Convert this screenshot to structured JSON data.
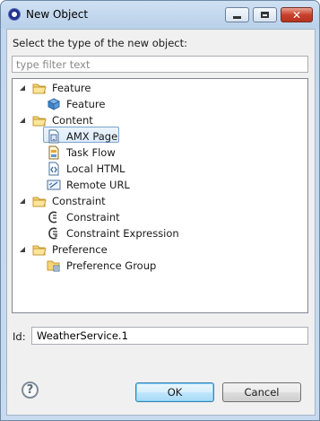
{
  "window": {
    "title": "New Object"
  },
  "dialog": {
    "prompt": "Select the type of the new object:",
    "filter": {
      "placeholder": "type filter text",
      "value": ""
    },
    "tree": [
      {
        "label": "Feature",
        "icon": "folder-icon",
        "expanded": true,
        "children": [
          {
            "label": "Feature",
            "icon": "feature-icon"
          }
        ]
      },
      {
        "label": "Content",
        "icon": "folder-icon",
        "expanded": true,
        "children": [
          {
            "label": "AMX Page",
            "icon": "amx-page-icon",
            "selected": true
          },
          {
            "label": "Task Flow",
            "icon": "task-flow-icon"
          },
          {
            "label": "Local HTML",
            "icon": "local-html-icon"
          },
          {
            "label": "Remote URL",
            "icon": "remote-url-icon"
          }
        ]
      },
      {
        "label": "Constraint",
        "icon": "folder-icon",
        "expanded": true,
        "children": [
          {
            "label": "Constraint",
            "icon": "constraint-icon"
          },
          {
            "label": "Constraint Expression",
            "icon": "constraint-expression-icon"
          }
        ]
      },
      {
        "label": "Preference",
        "icon": "folder-icon",
        "expanded": true,
        "children": [
          {
            "label": "Preference Group",
            "icon": "preference-group-icon"
          }
        ]
      }
    ],
    "id_label": "Id:",
    "id_value": "WeatherService.1",
    "ok_label": "OK",
    "cancel_label": "Cancel",
    "help_glyph": "?"
  },
  "colors": {
    "selection_fill": "#dcebfc",
    "selection_border": "#7da2ce",
    "folder": "#e8c15a",
    "ok_border": "#3c7fb1"
  }
}
